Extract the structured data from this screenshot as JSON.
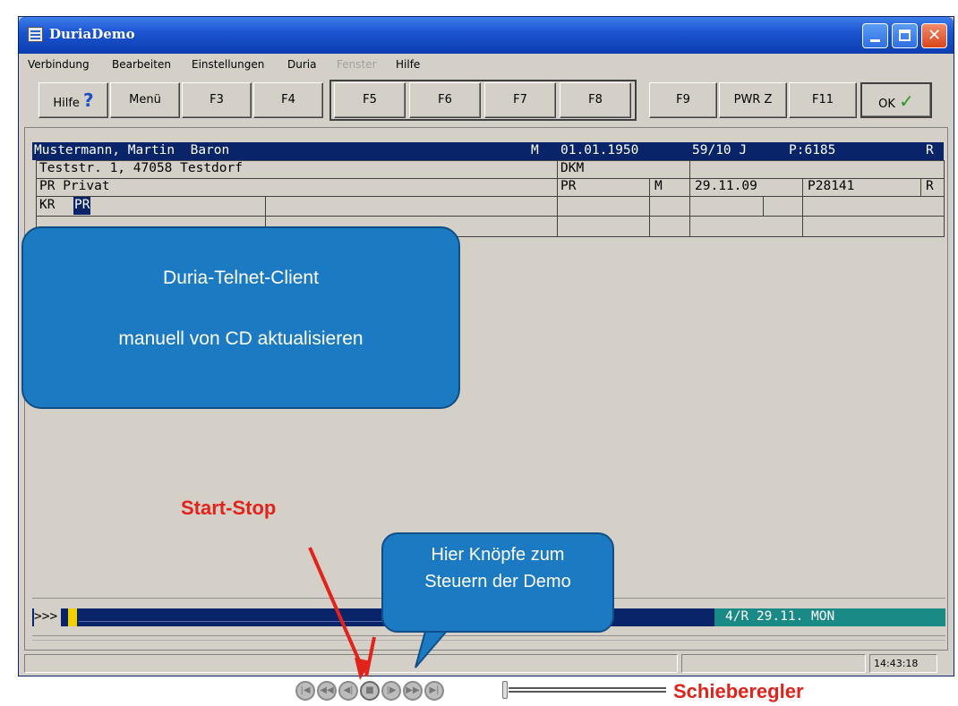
{
  "window": {
    "title": "DuriaDemo"
  },
  "menu": [
    "Verbindung",
    "Bearbeiten",
    "Einstellungen",
    "Duria",
    "Fenster",
    "Hilfe"
  ],
  "toolbar": {
    "hilfe": "Hilfe",
    "menu": "Menü",
    "f3": "F3",
    "f4": "F4",
    "f5": "F5",
    "f6": "F6",
    "f7": "F7",
    "f8": "F8",
    "f9": "F9",
    "pwrz": "PWR Z",
    "f11": "F11",
    "ok": "OK"
  },
  "patient": {
    "name": "Mustermann, Martin  Baron",
    "sex": "M",
    "dob": "01.01.1950",
    "age": "59/10 J",
    "pnum": "P:6185",
    "flag": "R",
    "address": "Teststr. 1, 47058 Testdorf",
    "addr_code": "DKM",
    "ins_label": "PR Privat",
    "ins_code": "PR",
    "ins_sex": "M",
    "ins_date": "29.11.09",
    "ins_num": "P28141",
    "ins_flag": "R",
    "kr_label": "KR",
    "kr_value": "PR"
  },
  "overlay": {
    "box_line1": "Duria-Telnet-Client",
    "box_line2": "manuell von CD aktualisieren",
    "start_stop": "Start-Stop",
    "callout_line1": "Hier Knöpfe zum",
    "callout_line2": "Steuern der Demo",
    "slider_label": "Schieberegler"
  },
  "command": {
    "prompt": ">>>",
    "dashes": "_______________________________________________________",
    "status": "4/R 29.11. MON"
  },
  "statusbar": {
    "time": "14:43:18"
  }
}
